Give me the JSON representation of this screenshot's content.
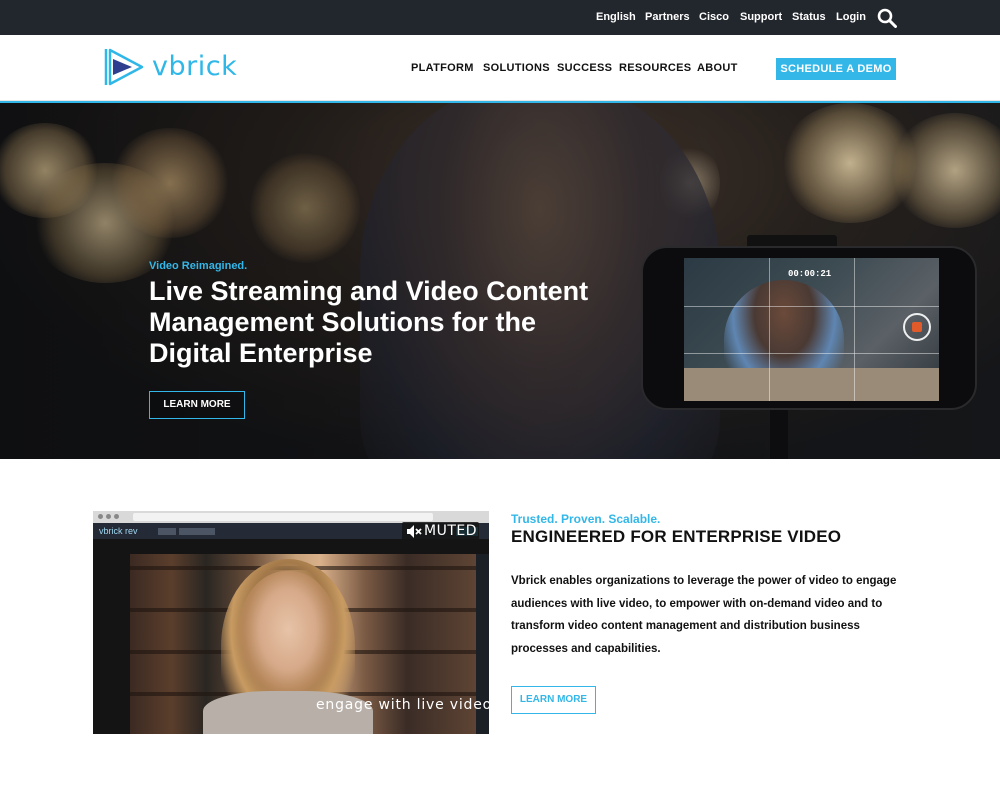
{
  "utility_nav": {
    "items": [
      {
        "label": "English"
      },
      {
        "label": "Partners"
      },
      {
        "label": "Cisco"
      },
      {
        "label": "Support"
      },
      {
        "label": "Status"
      },
      {
        "label": "Login"
      }
    ],
    "search_icon": "search-icon"
  },
  "header": {
    "logo_text": "vbrick",
    "nav": [
      {
        "label": "PLATFORM"
      },
      {
        "label": "SOLUTIONS"
      },
      {
        "label": "SUCCESS"
      },
      {
        "label": "RESOURCES"
      },
      {
        "label": "ABOUT"
      }
    ],
    "cta_label": "SCHEDULE A DEMO"
  },
  "hero": {
    "eyebrow": "Video Reimagined.",
    "title": "Live Streaming and Video Content Management Solutions for the Digital Enterprise",
    "button_label": "LEARN MORE",
    "phone_timer": "00:00:21"
  },
  "feature": {
    "video": {
      "app_name": "vbrick rev",
      "muted_label": "MUTED",
      "caption": "engage with live video"
    },
    "eyebrow": "Trusted. Proven. Scalable.",
    "title": "ENGINEERED FOR ENTERPRISE VIDEO",
    "body": "Vbrick enables organizations to leverage the power of video to engage audiences with live video, to empower with on-demand video and to transform video content management and distribution business processes and capabilities.",
    "button_label": "LEARN MORE"
  },
  "colors": {
    "accent": "#33b7e8",
    "utility_bar": "#22262d",
    "text": "#111111"
  }
}
